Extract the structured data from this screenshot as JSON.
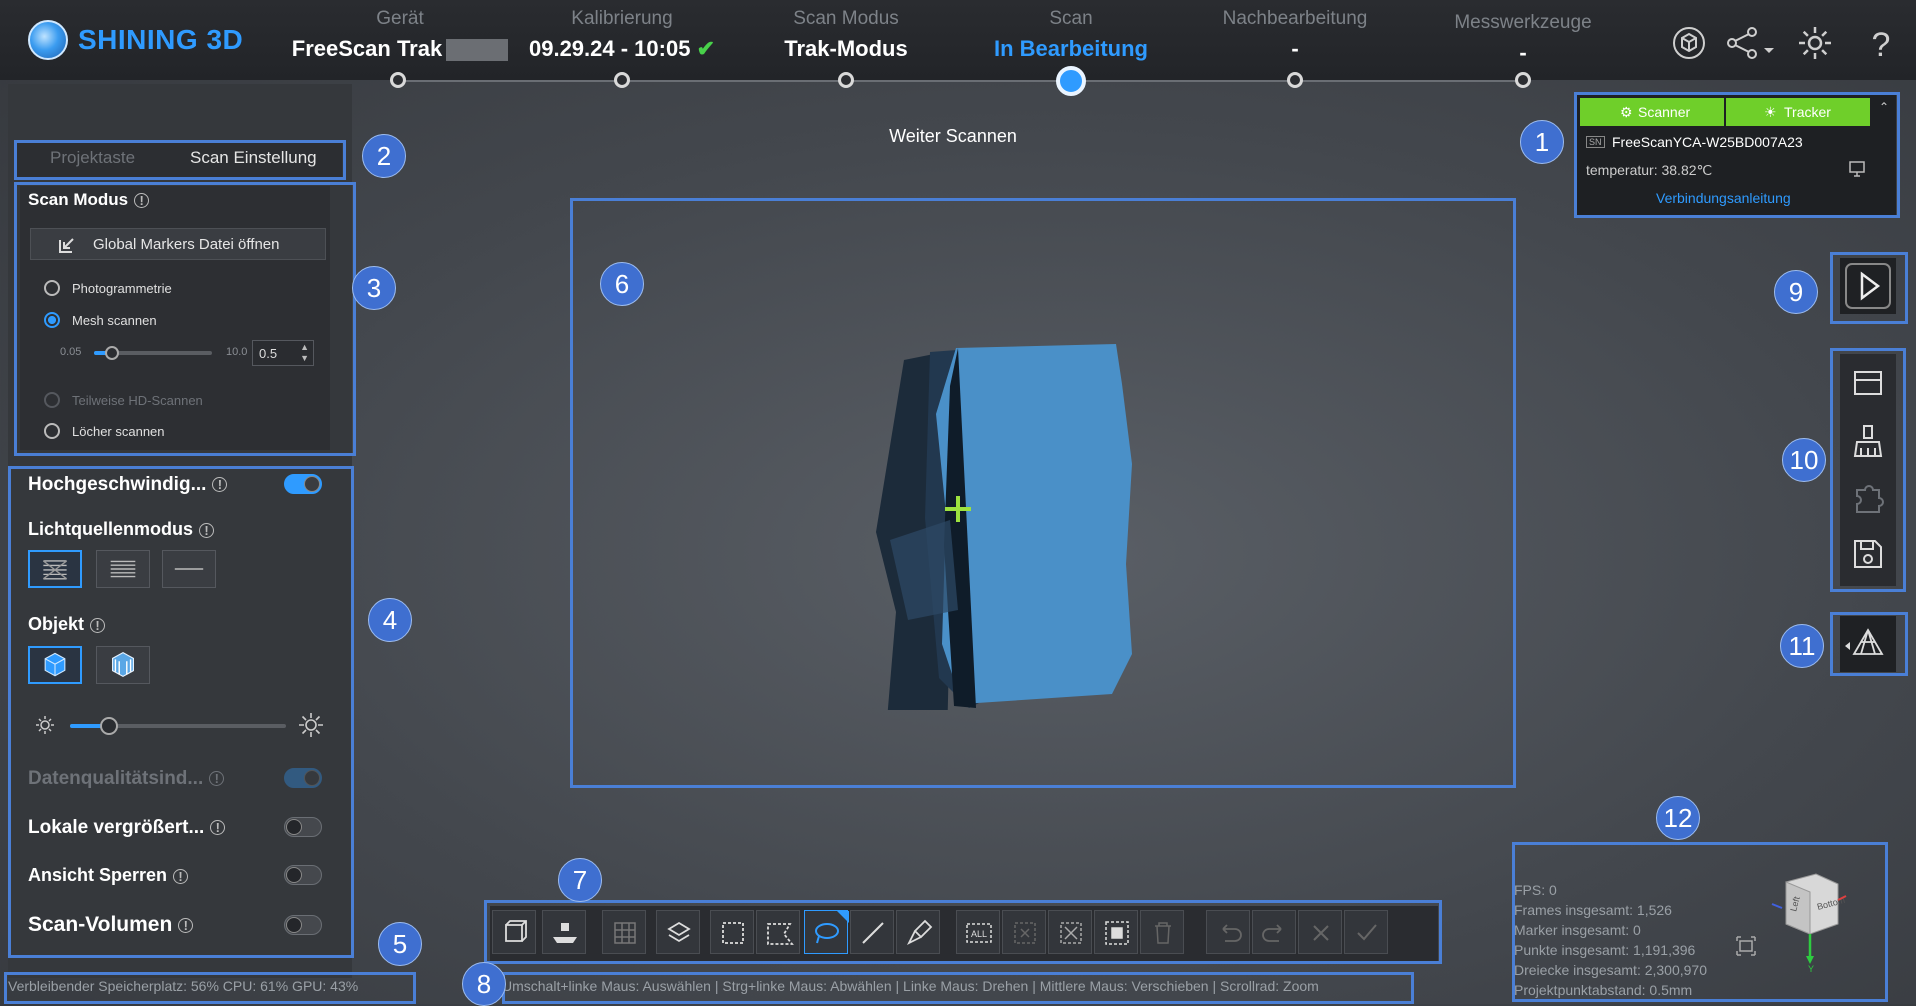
{
  "app": {
    "brand": "SHINING 3D"
  },
  "steps": [
    {
      "label": "Gerät",
      "value": "FreeScan Trak",
      "state": "done"
    },
    {
      "label": "Kalibrierung",
      "value": "09.29.24 - 10:05",
      "state": "done"
    },
    {
      "label": "Scan Modus",
      "value": "Trak-Modus",
      "state": "done"
    },
    {
      "label": "Scan",
      "value": "In Bearbeitung",
      "state": "active"
    },
    {
      "label": "Nachbearbeitung",
      "value": "-",
      "state": "pending"
    },
    {
      "label": "Messwerkzeuge",
      "value": "-",
      "state": "pending"
    }
  ],
  "status_banner": "Weiter Scannen",
  "left_panel": {
    "tabs": [
      "Projektaste",
      "Scan Einstellung"
    ],
    "scan_mode": {
      "title": "Scan Modus",
      "open_markers_label": "Global Markers Datei öffnen",
      "options": [
        {
          "label": "Photogrammetrie",
          "selected": false,
          "enabled": true
        },
        {
          "label": "Mesh scannen",
          "selected": true,
          "enabled": true
        },
        {
          "label": "Teilweise HD-Scannen",
          "selected": false,
          "enabled": false
        },
        {
          "label": "Löcher scannen",
          "selected": false,
          "enabled": true
        }
      ],
      "resolution_min": "0.05",
      "resolution_max": "10.0",
      "resolution_value": "0.5",
      "resolution_fraction": 0.05
    },
    "settings": {
      "high_speed": {
        "label": "Hochgeschwindig...",
        "on": true
      },
      "light_mode_label": "Lichtquellenmodus",
      "object_label": "Objekt",
      "brightness_fraction": 0.18,
      "data_quality": {
        "label": "Datenqualitätsind...",
        "on": true,
        "disabled": true
      },
      "local_zoom": {
        "label": "Lokale vergrößert...",
        "on": false
      },
      "lock_view": {
        "label": "Ansicht Sperren",
        "on": false
      },
      "scan_volume": {
        "label": "Scan-Volumen",
        "on": false
      }
    }
  },
  "device_panel": {
    "scanner_label": "Scanner",
    "tracker_label": "Tracker",
    "sn_tag": "SN",
    "serial": "FreeScanYCA-W25BD007A23",
    "temperature": "temperatur: 38.82℃",
    "connection_link": "Verbindungsanleitung"
  },
  "annotations": [
    "1",
    "2",
    "3",
    "4",
    "5",
    "6",
    "7",
    "8",
    "9",
    "10",
    "11",
    "12"
  ],
  "statusbar": {
    "system": "Verbleibender Speicherplatz: 56%  CPU: 61%  GPU: 43%",
    "hint": "Umschalt+linke Maus: Auswählen | Strg+linke Maus: Abwählen | Linke Maus: Drehen | Mittlere Maus: Verschieben | Scrollrad: Zoom"
  },
  "stats": {
    "fps": "FPS: 0",
    "frames": "Frames insgesamt: 1,526",
    "markers": "Marker insgesamt: 0",
    "points": "Punkte insgesamt: 1,191,396",
    "triangles": "Dreiecke insgesamt: 2,300,970",
    "point_distance": "Projektpunktabstand: 0.5mm"
  },
  "orientation_cube": {
    "left_face": "Left",
    "front_face": "Bottom",
    "axis_y": "Y"
  },
  "toolbar_select_all": "ALL",
  "colors": {
    "accent": "#2f9bff",
    "annotation": "#4a7fd6",
    "green_tab": "#6fcf2a",
    "scan_blue": "#4a90c8"
  }
}
